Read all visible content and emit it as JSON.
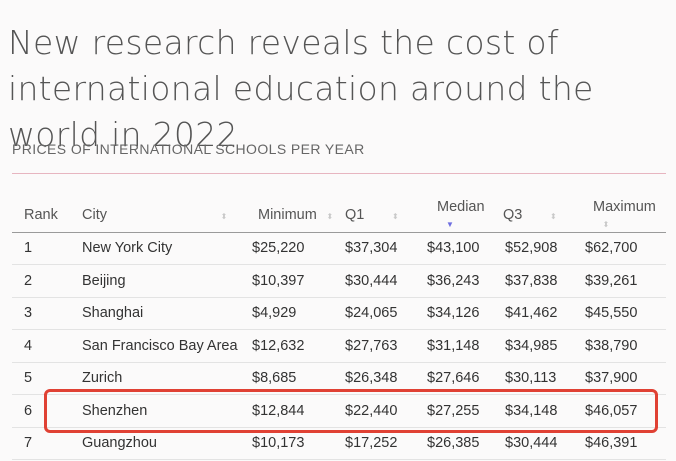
{
  "headline": "New research reveals the cost of international education around the world in 2022",
  "subhead": "PRICES OF INTERNATIONAL SCHOOLS PER YEAR",
  "table": {
    "columns": [
      "Rank",
      "City",
      "Minimum",
      "Q1",
      "Median",
      "Q3",
      "Maximum"
    ],
    "sort_icons": {
      "neutral": "⬍",
      "active": "▼"
    },
    "rows": [
      [
        "1",
        "New York City",
        "$25,220",
        "$37,304",
        "$43,100",
        "$52,908",
        "$62,700"
      ],
      [
        "2",
        "Beijing",
        "$10,397",
        "$30,444",
        "$36,243",
        "$37,838",
        "$39,261"
      ],
      [
        "3",
        "Shanghai",
        "$4,929",
        "$24,065",
        "$34,126",
        "$41,462",
        "$45,550"
      ],
      [
        "4",
        "San Francisco Bay Area",
        "$12,632",
        "$27,763",
        "$31,148",
        "$34,985",
        "$38,790"
      ],
      [
        "5",
        "Zurich",
        "$8,685",
        "$26,348",
        "$27,646",
        "$30,113",
        "$37,900"
      ],
      [
        "6",
        "Shenzhen",
        "$12,844",
        "$22,440",
        "$27,255",
        "$34,148",
        "$46,057"
      ],
      [
        "7",
        "Guangzhou",
        "$10,173",
        "$17,252",
        "$26,385",
        "$30,444",
        "$46,391"
      ]
    ]
  },
  "colors": {
    "highlight": "#e04134",
    "accent_rule": "#e7b5c0",
    "sort_active": "#6e6ee0"
  }
}
